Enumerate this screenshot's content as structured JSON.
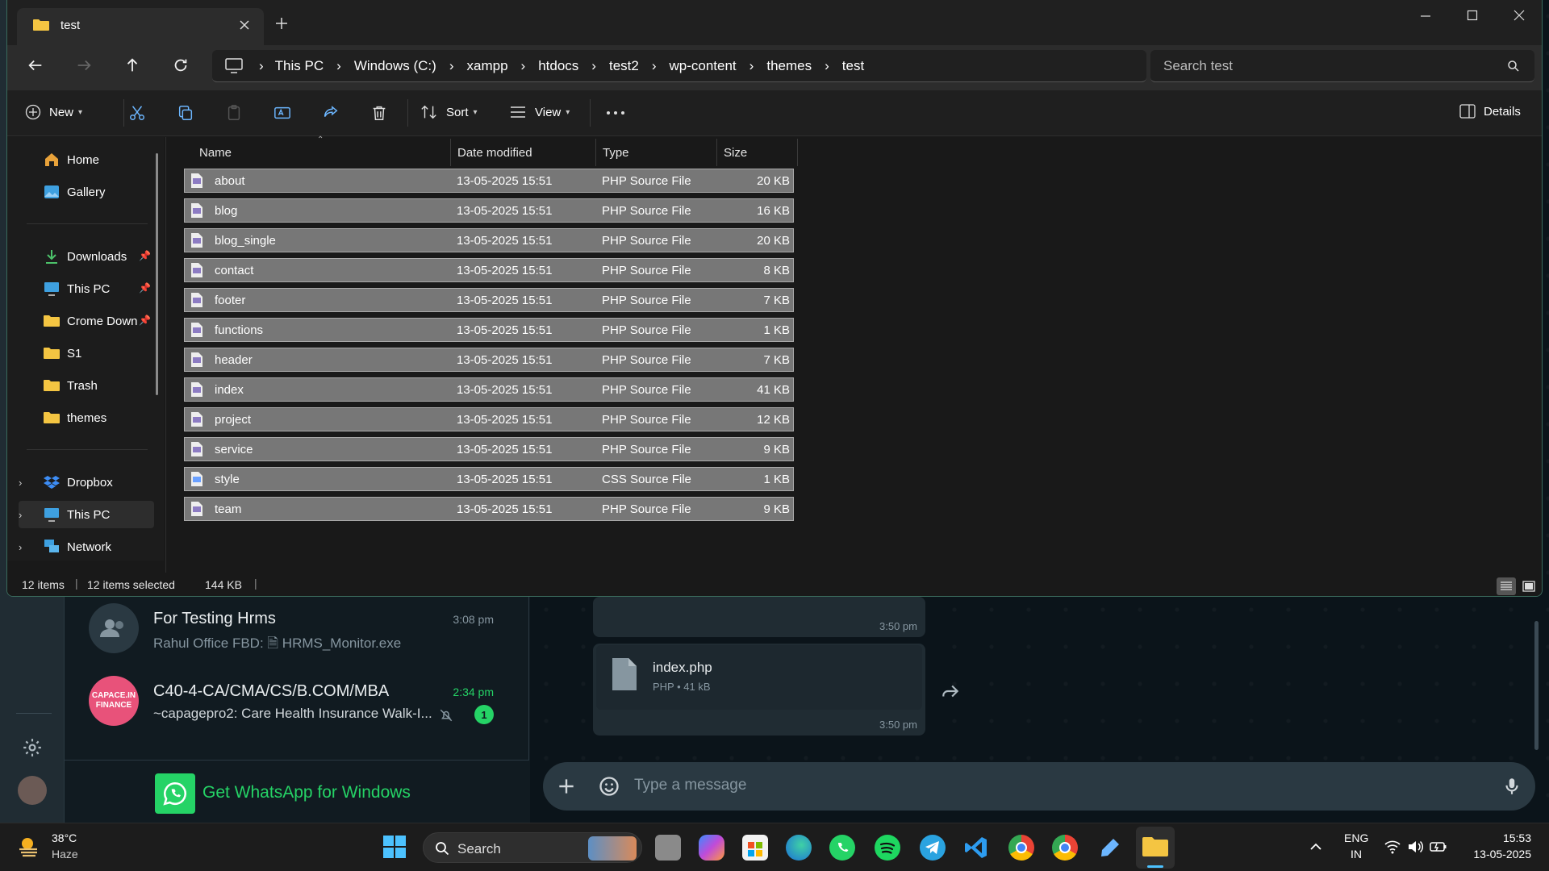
{
  "explorer": {
    "tab_title": "test",
    "breadcrumb": [
      "This PC",
      "Windows (C:)",
      "xampp",
      "htdocs",
      "test2",
      "wp-content",
      "themes",
      "test"
    ],
    "search_placeholder": "Search test",
    "toolbar": {
      "new_label": "New",
      "sort_label": "Sort",
      "view_label": "View",
      "details_label": "Details"
    },
    "nav_items": [
      {
        "label": "Home",
        "icon": "home-icon"
      },
      {
        "label": "Gallery",
        "icon": "gallery-icon"
      },
      {
        "label": "Downloads",
        "icon": "download-icon",
        "pinned": true
      },
      {
        "label": "This PC",
        "icon": "pc-icon",
        "pinned": true
      },
      {
        "label": "Crome Down",
        "icon": "folder-icon",
        "pinned": true
      },
      {
        "label": "S1",
        "icon": "folder-icon"
      },
      {
        "label": "Trash",
        "icon": "folder-icon"
      },
      {
        "label": "themes",
        "icon": "folder-icon"
      },
      {
        "label": "Dropbox",
        "icon": "dropbox-icon"
      },
      {
        "label": "This PC",
        "icon": "pc-icon",
        "selected": true
      },
      {
        "label": "Network",
        "icon": "network-icon"
      }
    ],
    "columns": [
      "Name",
      "Date modified",
      "Type",
      "Size"
    ],
    "files": [
      {
        "name": "about",
        "date": "13-05-2025 15:51",
        "type": "PHP Source File",
        "size": "20 KB"
      },
      {
        "name": "blog",
        "date": "13-05-2025 15:51",
        "type": "PHP Source File",
        "size": "16 KB"
      },
      {
        "name": "blog_single",
        "date": "13-05-2025 15:51",
        "type": "PHP Source File",
        "size": "20 KB"
      },
      {
        "name": "contact",
        "date": "13-05-2025 15:51",
        "type": "PHP Source File",
        "size": "8 KB"
      },
      {
        "name": "footer",
        "date": "13-05-2025 15:51",
        "type": "PHP Source File",
        "size": "7 KB"
      },
      {
        "name": "functions",
        "date": "13-05-2025 15:51",
        "type": "PHP Source File",
        "size": "1 KB"
      },
      {
        "name": "header",
        "date": "13-05-2025 15:51",
        "type": "PHP Source File",
        "size": "7 KB"
      },
      {
        "name": "index",
        "date": "13-05-2025 15:51",
        "type": "PHP Source File",
        "size": "41 KB"
      },
      {
        "name": "project",
        "date": "13-05-2025 15:51",
        "type": "PHP Source File",
        "size": "12 KB"
      },
      {
        "name": "service",
        "date": "13-05-2025 15:51",
        "type": "PHP Source File",
        "size": "9 KB"
      },
      {
        "name": "style",
        "date": "13-05-2025 15:51",
        "type": "CSS Source File",
        "size": "1 KB"
      },
      {
        "name": "team",
        "date": "13-05-2025 15:51",
        "type": "PHP Source File",
        "size": "9 KB"
      }
    ],
    "status": {
      "count": "12 items",
      "selected": "12 items selected",
      "size": "144 KB"
    }
  },
  "whatsapp": {
    "chats": [
      {
        "title": "For Testing Hrms",
        "subtitle": "Rahul Office FBD: 🗎 HRMS_Monitor.exe",
        "time": "3:08 pm"
      },
      {
        "title": "C40-4-CA/CMA/CS/B.COM/MBA",
        "subtitle": "~capagepro2: Care Health Insurance Walk-I...",
        "time": "2:34 pm",
        "unread": "1",
        "avatar_text": "CAPACE.IN FINANCE"
      }
    ],
    "get_app_label": "Get WhatsApp for Windows",
    "messages": [
      {
        "time": "3:50 pm"
      },
      {
        "file_name": "index.php",
        "file_meta": "PHP • 41 kB",
        "time": "3:50 pm"
      }
    ],
    "composer_placeholder": "Type a message"
  },
  "taskbar": {
    "weather_temp": "38°C",
    "weather_desc": "Haze",
    "search_label": "Search",
    "lang": "ENG",
    "region": "IN",
    "time": "15:53",
    "date": "13-05-2025"
  },
  "colors": {
    "whatsapp_green": "#25d366",
    "selection": "#777777",
    "accent_border": "#3a6b5c"
  }
}
